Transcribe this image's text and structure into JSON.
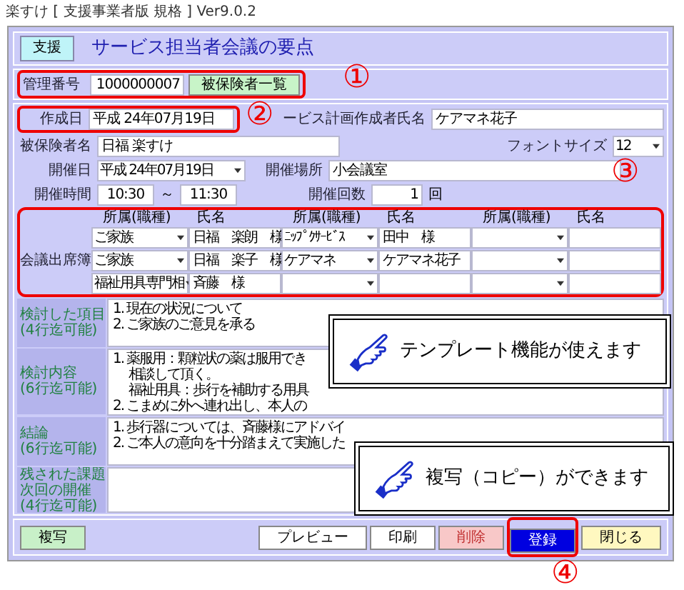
{
  "window": {
    "title": "楽すけ [ 支援事業者版 規格 ] Ver9.0.2"
  },
  "header": {
    "badge": "支援",
    "title": "サービス担当者会議の要点"
  },
  "management": {
    "label": "管理番号",
    "value": "1000000007",
    "button": "被保険者一覧"
  },
  "created": {
    "label": "作成日",
    "value": "平成 24年07月19日"
  },
  "planner": {
    "label": "ービス計画作成者氏名",
    "value": "ケアマネ花子"
  },
  "insured": {
    "label": "被保険者名",
    "value": "日福 楽すけ"
  },
  "font_size": {
    "label": "フォントサイズ",
    "value": "12"
  },
  "meeting_date": {
    "label": "開催日",
    "value": "平成 24年07月19日"
  },
  "place": {
    "label": "開催場所",
    "value": "小会議室"
  },
  "time": {
    "label": "開催時間",
    "start": "10:30",
    "separator": "～",
    "end": "11:30"
  },
  "count": {
    "label": "開催回数",
    "value": "1",
    "unit": "回"
  },
  "attendees": {
    "label": "会議出席簿",
    "columns": [
      "所属(職種)",
      "氏名",
      "所属(職種)",
      "氏名",
      "所属(職種)",
      "氏名"
    ],
    "rows": [
      [
        "ご家族",
        "日福　楽朗　様",
        "ﾆｯﾌﾟｸｻｰﾋﾞｽ",
        "田中　様"
      ],
      [
        "ご家族",
        "日福　楽子　様",
        "ケアマネ",
        "ケアマネ花子"
      ],
      [
        "福祉用具専門相",
        "斉藤　様"
      ]
    ]
  },
  "notes": [
    {
      "label": "検討した項目",
      "hint": "(4行迄可能)",
      "lines": [
        "1. 現在の状況について",
        "2. ご家族のご意見を承る"
      ]
    },
    {
      "label": "検討内容",
      "hint": "(6行迄可能)",
      "lines": [
        "1. 薬服用：顆粒状の薬は服用でき",
        "　 相談して頂く。",
        "　 福祉用具：歩行を補助する用具",
        "2. こまめに外へ連れ出し、本人の"
      ]
    },
    {
      "label": "結論",
      "hint": "(6行迄可能)",
      "lines": [
        "1. 歩行器については、斉藤様にアドバイ",
        "2. ご本人の意向を十分踏まえて実施した"
      ]
    },
    {
      "label": "残された課題次回の開催",
      "hint": "(4行迄可能)"
    }
  ],
  "callouts": [
    {
      "text": "テンプレート機能が使えます"
    },
    {
      "text": "複写（コピー）ができます"
    }
  ],
  "annotations": [
    "①",
    "②",
    "③",
    "④"
  ],
  "buttons": [
    {
      "label": "複写",
      "kind": "copy"
    },
    {
      "label": "プレビュー",
      "kind": "plain"
    },
    {
      "label": "印刷",
      "kind": "plain"
    },
    {
      "label": "削除",
      "kind": "delete"
    },
    {
      "label": "登録",
      "kind": "save"
    },
    {
      "label": "閉じる",
      "kind": "close"
    }
  ]
}
